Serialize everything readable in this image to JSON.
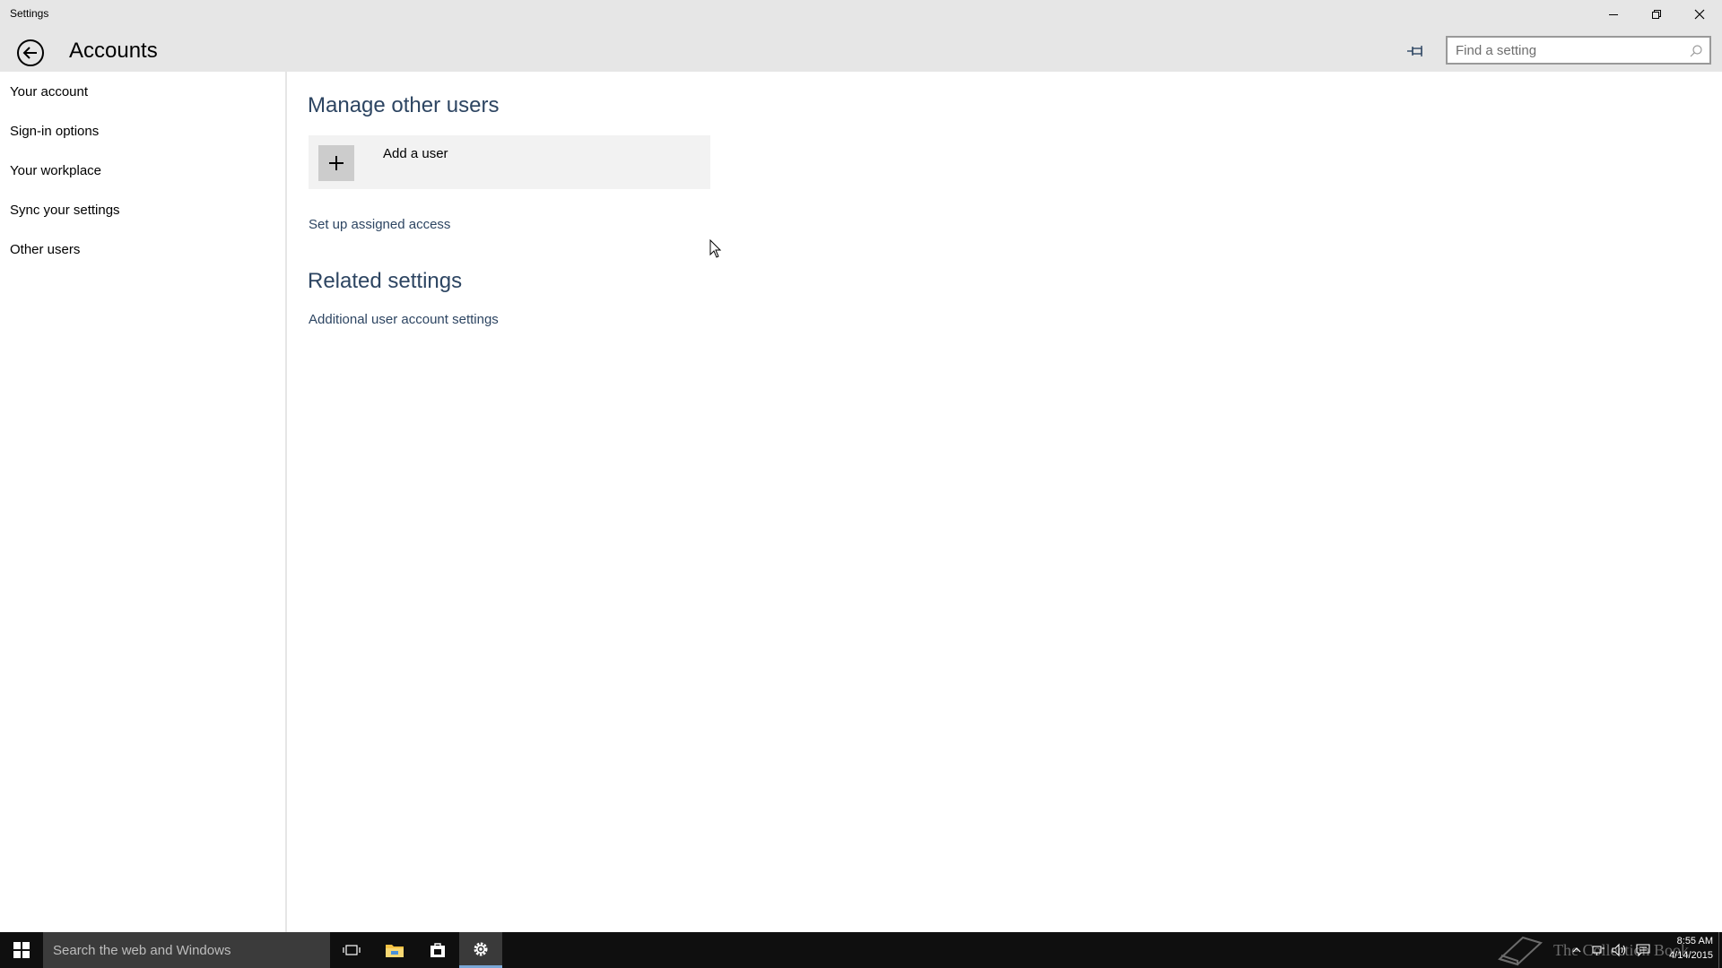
{
  "window": {
    "title": "Settings"
  },
  "header": {
    "page_title": "Accounts",
    "search_placeholder": "Find a setting"
  },
  "sidebar": {
    "items": [
      {
        "label": "Your account"
      },
      {
        "label": "Sign-in options"
      },
      {
        "label": "Your workplace"
      },
      {
        "label": "Sync your settings"
      },
      {
        "label": "Other users"
      }
    ]
  },
  "main": {
    "manage_title": "Manage other users",
    "add_user_label": "Add a user",
    "assigned_access_link": "Set up assigned access",
    "related_title": "Related settings",
    "additional_settings_link": "Additional user account settings"
  },
  "taskbar": {
    "search_placeholder": "Search the web and Windows",
    "watermark": "The Collection Book",
    "time": "8:55 AM",
    "date": "4/14/2015"
  },
  "colors": {
    "titlebar_bg": "#e6e6e6",
    "accent_text": "#2d4562",
    "taskbar_bg": "#0f0f0f",
    "active_app_underline": "#7aa7d6"
  },
  "icons": {
    "back": "back-arrow-icon",
    "pin": "pin-icon",
    "search": "search-icon",
    "minimize": "minimize-icon",
    "restore": "restore-icon",
    "close": "close-icon",
    "add": "plus-icon",
    "start": "windows-logo-icon",
    "task_view": "task-view-icon",
    "file_explorer": "folder-icon",
    "store": "store-icon",
    "settings": "gear-icon"
  }
}
